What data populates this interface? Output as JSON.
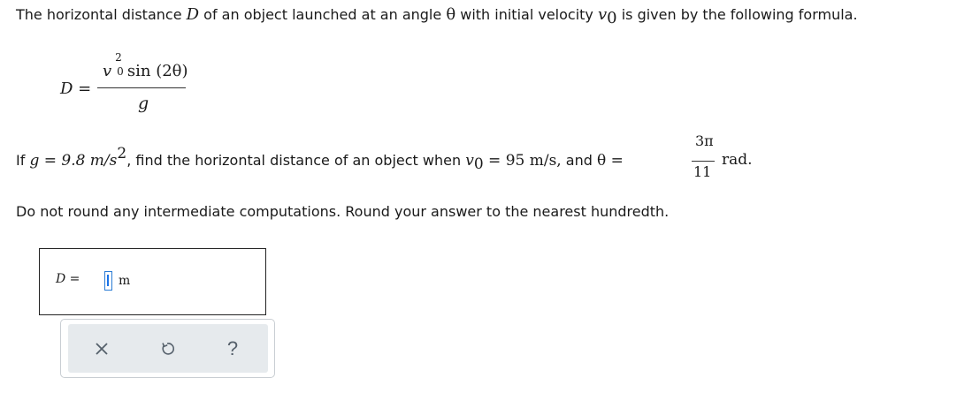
{
  "problem": {
    "intro": {
      "part1": "The horizontal distance ",
      "var_D": "D",
      "part2": " of an object launched at an angle ",
      "theta": "θ",
      "part3": " with initial velocity ",
      "v": "v",
      "sub0": "0",
      "part4": " is given by the following formula."
    },
    "formula": {
      "lhs": "D =",
      "v": "v",
      "sup2": "2",
      "sub0": "0",
      "numerator_rest": " sin (2θ)",
      "denominator": "g"
    },
    "question": {
      "part1": "If ",
      "g_expr": "g = 9.8 m/s",
      "sup2": "2",
      "part2": ", find the horizontal distance of an object when ",
      "v": "v",
      "sub0": "0",
      "v_expr": " = 95 m/s,",
      "part3": " and ",
      "theta_eq": "θ =",
      "theta_num": "3π",
      "theta_den": "11",
      "rad": "rad."
    },
    "instruction": "Do not round any intermediate computations. Round your answer to the nearest hundredth."
  },
  "answer": {
    "label": "D =",
    "value": "",
    "unit": "m"
  },
  "toolbar": {
    "icons": [
      "close-icon",
      "undo-icon",
      "help-icon"
    ],
    "help_glyph": "?"
  },
  "colors": {
    "input_border": "#2a7bd4",
    "toolbar_bg": "#e6eaed",
    "icon": "#55606b"
  }
}
